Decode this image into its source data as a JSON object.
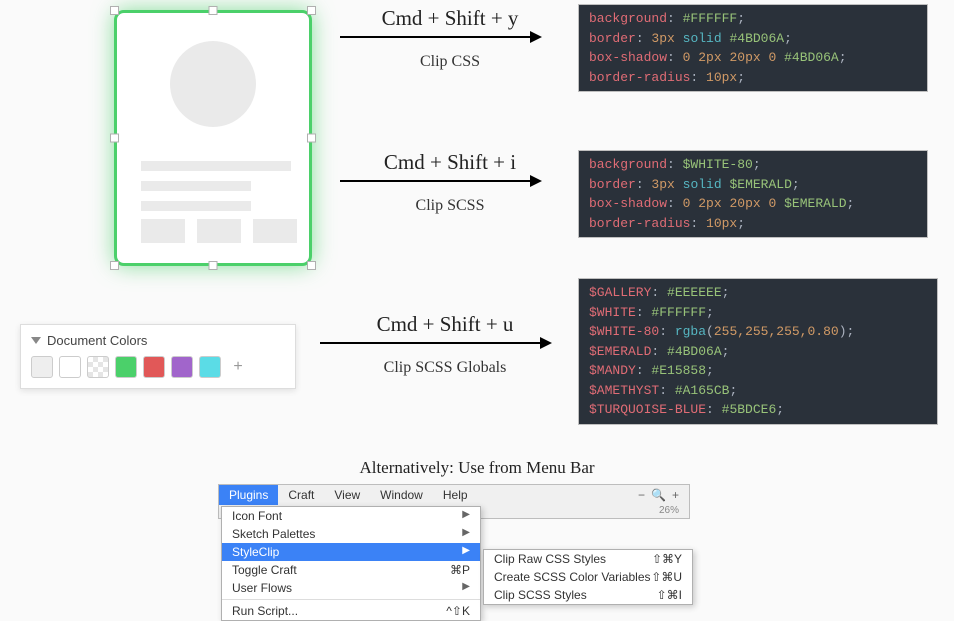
{
  "shortcuts": [
    {
      "keys": "Cmd + Shift + y",
      "desc": "Clip CSS"
    },
    {
      "keys": "Cmd + Shift + i",
      "desc": "Clip SCSS"
    },
    {
      "keys": "Cmd + Shift + u",
      "desc": "Clip SCSS Globals"
    }
  ],
  "code_css": {
    "l1_prop": "background",
    "l1_val": "#FFFFFF",
    "l2_prop": "border",
    "l2_num": "3px",
    "l2_kw": "solid",
    "l2_val": "#4BD06A",
    "l3_prop": "box-shadow",
    "l3_a": "0",
    "l3_b": "2px",
    "l3_c": "20px",
    "l3_d": "0",
    "l3_val": "#4BD06A",
    "l4_prop": "border-radius",
    "l4_num": "10px"
  },
  "code_scss": {
    "l1_prop": "background",
    "l1_val": "$WHITE-80",
    "l2_prop": "border",
    "l2_num": "3px",
    "l2_kw": "solid",
    "l2_val": "$EMERALD",
    "l3_prop": "box-shadow",
    "l3_a": "0",
    "l3_b": "2px",
    "l3_c": "20px",
    "l3_d": "0",
    "l3_val": "$EMERALD",
    "l4_prop": "border-radius",
    "l4_num": "10px"
  },
  "code_globals": {
    "g0v": "$GALLERY",
    "g0c": "#EEEEEE",
    "g1v": "$WHITE",
    "g1c": "#FFFFFF",
    "g2v": "$WHITE-80",
    "g2fn": "rgba",
    "g2args": "255,255,255,",
    "g2a": "0.80",
    "g3v": "$EMERALD",
    "g3c": "#4BD06A",
    "g4v": "$MANDY",
    "g4c": "#E15858",
    "g5v": "$AMETHYST",
    "g5c": "#A165CB",
    "g6v": "$TURQUOISE-BLUE",
    "g6c": "#5BDCE6"
  },
  "doc_colors_title": "Document Colors",
  "swatches": [
    "#eeeeee",
    "#ffffff",
    "checker",
    "#4BD06A",
    "#E15858",
    "#A165CB",
    "#5BDCE6"
  ],
  "plus": "+",
  "alt_title": "Alternatively: Use from Menu Bar",
  "menubar": {
    "items": [
      "Plugins",
      "Craft",
      "View",
      "Window",
      "Help"
    ],
    "zoom_minus": "−",
    "zoom_plus": "+",
    "zoom_pct": "26%",
    "drop": [
      {
        "label": "Icon Font",
        "right": "▶"
      },
      {
        "label": "Sketch Palettes",
        "right": "▶"
      },
      {
        "label": "StyleClip",
        "right": "▶",
        "sel": true
      },
      {
        "label": "Toggle Craft",
        "right": "⌘P"
      },
      {
        "label": "User Flows",
        "right": "▶"
      },
      {
        "sep": true
      },
      {
        "label": "Run Script...",
        "right": "^⇧K"
      }
    ],
    "sub": [
      {
        "label": "Clip Raw CSS Styles",
        "right": "⇧⌘Y"
      },
      {
        "label": "Create SCSS Color Variables",
        "right": "⇧⌘U"
      },
      {
        "label": "Clip SCSS Styles",
        "right": "⇧⌘I"
      }
    ]
  }
}
